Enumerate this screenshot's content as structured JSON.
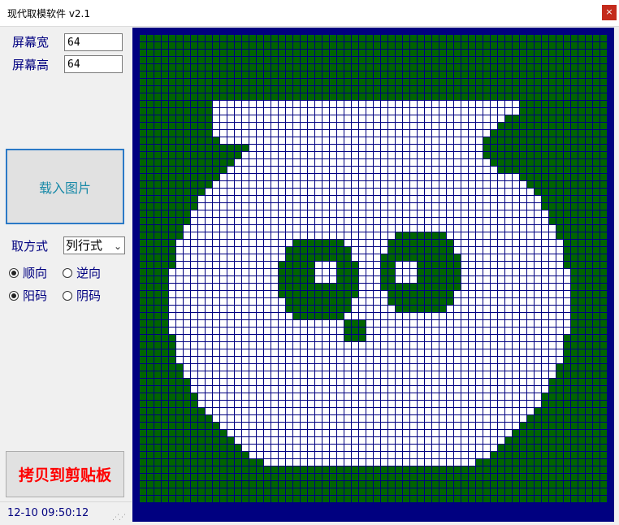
{
  "window": {
    "title": "现代取模软件 v2.1",
    "close_icon": "×"
  },
  "settings": {
    "width_label": "屏幕宽",
    "width_value": "64",
    "height_label": "屏幕高",
    "height_value": "64"
  },
  "load_button": {
    "label": "载入图片"
  },
  "mode": {
    "label": "取方式",
    "selected": "列行式",
    "options": [
      "列行式"
    ]
  },
  "direction": {
    "forward_label": "顺向",
    "reverse_label": "逆向",
    "selected": "forward"
  },
  "polarity": {
    "positive_label": "阳码",
    "negative_label": "阴码",
    "selected": "positive"
  },
  "copy_button": {
    "label": "拷贝到剪贴板"
  },
  "status": {
    "time": "12-10 09:50:12"
  },
  "preview": {
    "grid_cols": 64,
    "grid_rows": 64,
    "colors": {
      "background": "#000080",
      "pixel_off": "#006400",
      "pixel_on": "#ffffff",
      "grid_line": "#000080"
    },
    "shape": "panda face",
    "pixel_on_count_per_row": "derived"
  }
}
